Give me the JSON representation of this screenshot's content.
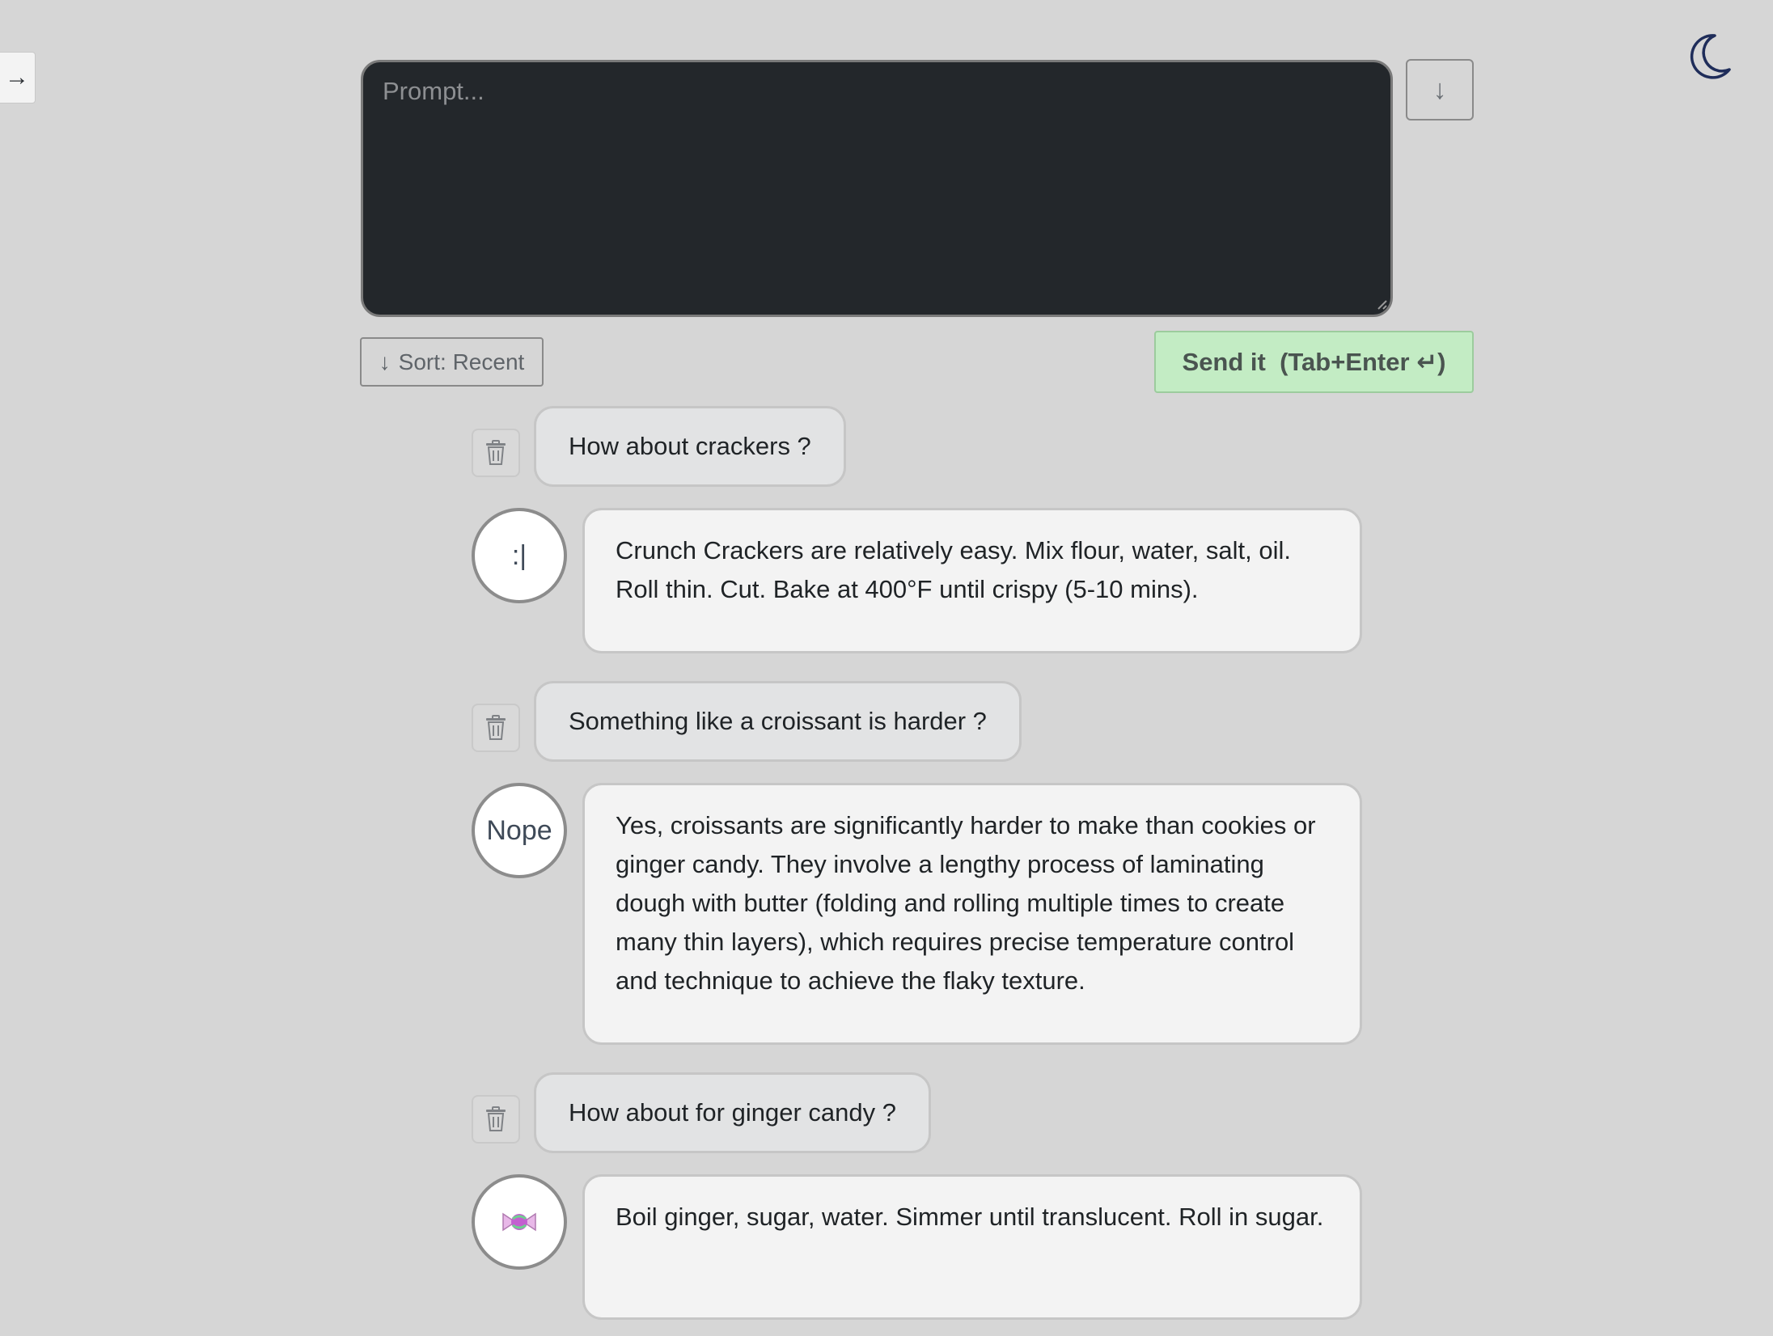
{
  "sidebar": {
    "toggle_icon": "arrow-right-icon",
    "toggle_glyph": "→"
  },
  "header": {
    "theme_icon": "moon-icon"
  },
  "composer": {
    "placeholder": "Prompt...",
    "value": "",
    "scroll_down_glyph": "↓",
    "sort_glyph": "↓",
    "sort_label": "Sort: Recent",
    "send_label": "Send it  (Tab+Enter ↵)",
    "send_color": "#c3ecc4"
  },
  "conversation": [
    {
      "question": "How about crackers ?",
      "avatar": ":|",
      "answer": "Crunch Crackers are relatively easy. Mix flour, water, salt, oil. Roll thin. Cut. Bake at 400°F until crispy (5-10 mins)."
    },
    {
      "question": "Something like a croissant is harder ?",
      "avatar": "Nope",
      "answer": "Yes, croissants are significantly harder to make than cookies or ginger candy. They involve a lengthy process of laminating dough with butter (folding and rolling multiple times to create many thin layers), which requires precise temperature control and technique to achieve the flaky texture."
    },
    {
      "question": "How about for ginger candy ?",
      "avatar_icon": "candy-icon",
      "answer": "Boil ginger, sugar, water. Simmer until translucent. Roll in sugar."
    }
  ]
}
